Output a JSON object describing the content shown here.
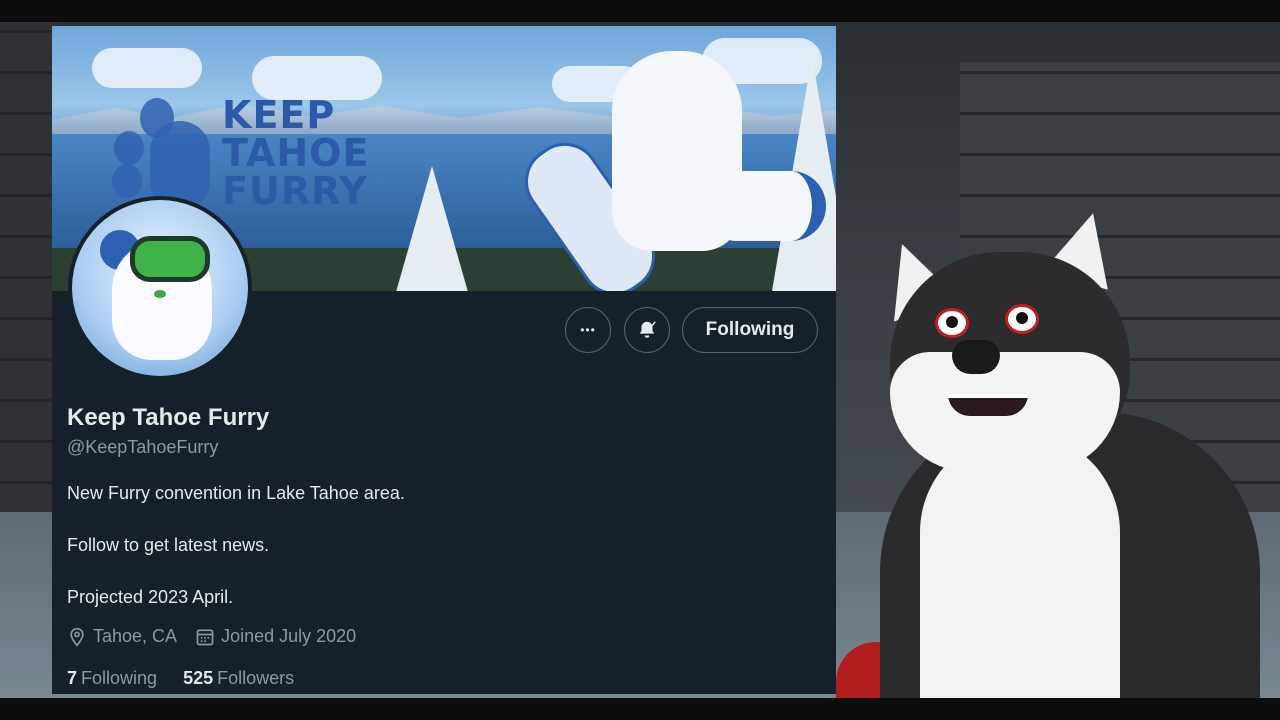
{
  "banner": {
    "title_lines": [
      "KEEP",
      "TAHOE",
      "FURRY"
    ]
  },
  "profile": {
    "name": "Keep Tahoe Furry",
    "handle": "@KeepTahoeFurry",
    "bio": [
      "New Furry convention in Lake Tahoe area.",
      "Follow to get latest news.",
      "Projected 2023 April."
    ],
    "location": "Tahoe, CA",
    "joined": "Joined July 2020",
    "following_count": "7",
    "following_label": "Following",
    "followers_count": "525",
    "followers_label": "Followers"
  },
  "actions": {
    "more_glyph": "•••",
    "bell_glyph": "🔔",
    "following_button": "Following"
  },
  "icons": {
    "more": "more-icon",
    "bell": "notification-bell-icon",
    "location": "location-pin-icon",
    "calendar": "calendar-icon"
  },
  "colors": {
    "card_bg": "#15202b",
    "text_primary": "#e7e9ea",
    "text_secondary": "#8b98a5",
    "border": "#536471",
    "banner_brand": "#2a5aa8"
  }
}
